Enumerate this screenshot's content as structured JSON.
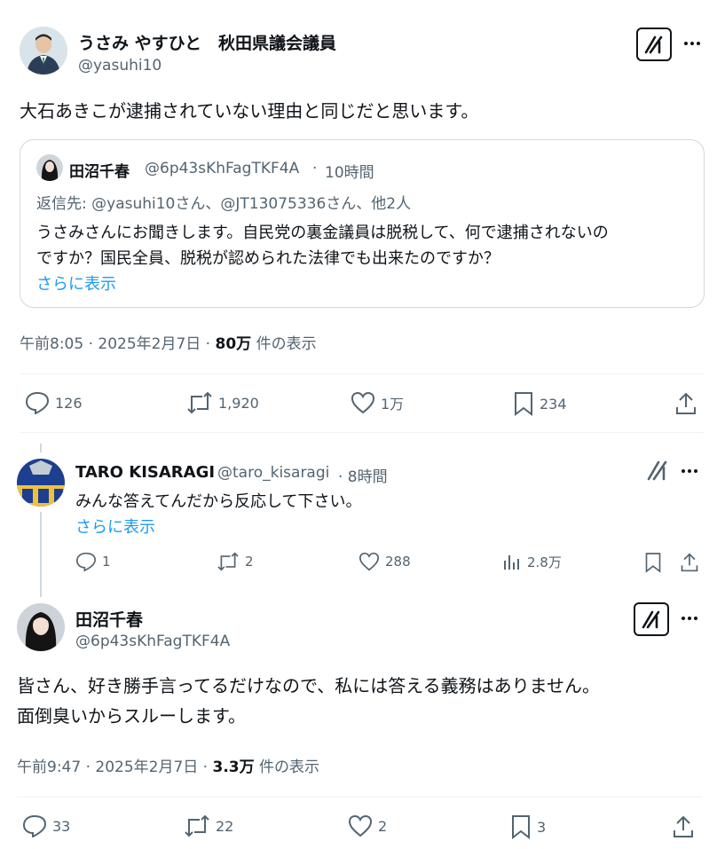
{
  "main_post": {
    "author_name": "うさみ やすひと　秋田県議会議員",
    "author_handle": "@yasuhi10",
    "text": "大石あきこが逮捕されていない理由と同じだと思います。",
    "quoted": {
      "author_name": "田沼千春",
      "author_handle": "@6p43sKhFagTKF4A",
      "time": "10時間",
      "reply_to": "返信先: @yasuhi10さん、@JT13075336さん、他2人",
      "text_line1": "うさみさんにお聞きします。自民党の裏金議員は脱税して、何で逮捕されないの",
      "text_line2": "ですか？国民全員、脱税が認められた法律でも出来たのですか？",
      "show_more": "さらに表示"
    },
    "meta_time": "午前8:05 · 2025年2月7日 · ",
    "meta_views": "80万",
    "meta_views_label": " 件の表示",
    "stats": {
      "replies": "126",
      "reposts": "1,920",
      "likes": "1万",
      "bookmarks": "234"
    }
  },
  "reply": {
    "author_name": "TARO KISARAGI",
    "author_handle": "@taro_kisaragi",
    "time": "· 8時間",
    "text": "みんな答えてんだから反応して下さい。",
    "show_more": "さらに表示",
    "stats": {
      "replies": "1",
      "reposts": "2",
      "likes": "288",
      "views": "2.8万"
    }
  },
  "second_post": {
    "author_name": "田沼千春",
    "author_handle": "@6p43sKhFagTKF4A",
    "text_line1": "皆さん、好き勝手言ってるだけなので、私には答える義務はありません。",
    "text_line2": "面倒臭いからスルーします。",
    "meta_time": "午前9:47 · 2025年2月7日 · ",
    "meta_views": "3.3万",
    "meta_views_label": " 件の表示",
    "stats": {
      "replies": "33",
      "reposts": "22",
      "likes": "2",
      "bookmarks": "3"
    }
  },
  "colors": {
    "text": "#0f1419",
    "muted": "#536471",
    "link": "#1d9bf0",
    "border": "#cfd9de"
  }
}
